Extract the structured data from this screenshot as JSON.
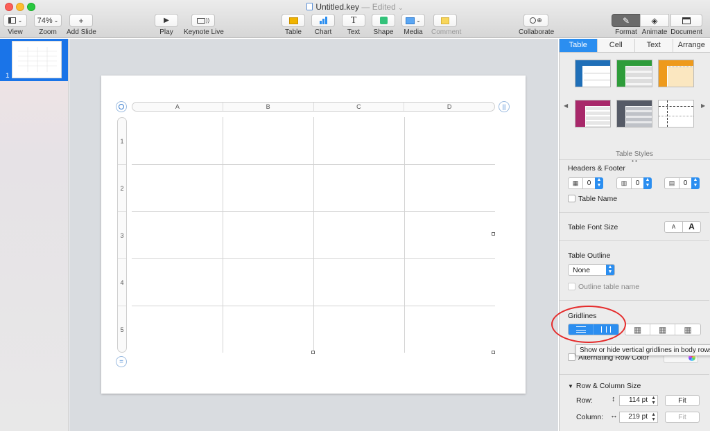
{
  "window": {
    "title": "Untitled.key",
    "status": "— Edited",
    "dropdown": "⌄"
  },
  "toolbar": {
    "view": {
      "label": "View",
      "icon": "sidebar-icon"
    },
    "zoom": {
      "label": "Zoom",
      "value": "74%"
    },
    "add_slide": {
      "label": "Add Slide",
      "icon": "plus-icon"
    },
    "play": {
      "label": "Play",
      "icon": "play-icon"
    },
    "keynote_live": {
      "label": "Keynote Live",
      "icon": "keynote-live-icon"
    },
    "table": {
      "label": "Table",
      "icon": "table-icon"
    },
    "chart": {
      "label": "Chart",
      "icon": "chart-icon"
    },
    "text": {
      "label": "Text",
      "icon": "text-icon"
    },
    "shape": {
      "label": "Shape",
      "icon": "shape-icon"
    },
    "media": {
      "label": "Media",
      "icon": "media-icon"
    },
    "comment": {
      "label": "Comment",
      "icon": "comment-icon"
    },
    "collaborate": {
      "label": "Collaborate",
      "icon": "collaborate-icon"
    },
    "format": {
      "label": "Format",
      "icon": "paintbrush-icon"
    },
    "animate": {
      "label": "Animate",
      "icon": "animate-icon"
    },
    "document": {
      "label": "Document",
      "icon": "document-icon"
    }
  },
  "navigator": {
    "slide_number": "1"
  },
  "table": {
    "columns": [
      "A",
      "B",
      "C",
      "D"
    ],
    "rows": [
      "1",
      "2",
      "3",
      "4",
      "5"
    ]
  },
  "inspector": {
    "tabs": [
      "Table",
      "Cell",
      "Text",
      "Arrange"
    ],
    "active_tab": "Table",
    "table_styles_label": "Table Styles",
    "style_colors": [
      "#1f6fb8",
      "#2e9c3a",
      "#ee9a1c",
      "#a8286a",
      "#555a66",
      "#ffffff"
    ],
    "headers_footer": {
      "title": "Headers & Footer",
      "header_rows": "0",
      "header_columns": "0",
      "footer_rows": "0",
      "table_name_label": "Table Name"
    },
    "font_size": {
      "title": "Table Font Size",
      "smaller": "A",
      "larger": "A"
    },
    "outline": {
      "title": "Table Outline",
      "value": "None",
      "outline_name_label": "Outline table name"
    },
    "gridlines": {
      "title": "Gridlines"
    },
    "tooltip": "Show or hide vertical gridlines in body rows.",
    "alternating_row_label": "Alternating Row Color",
    "row_column_size": {
      "title": "Row & Column Size",
      "row_label": "Row:",
      "row_value": "114 pt",
      "column_label": "Column:",
      "column_value": "219 pt",
      "fit_label": "Fit"
    }
  }
}
